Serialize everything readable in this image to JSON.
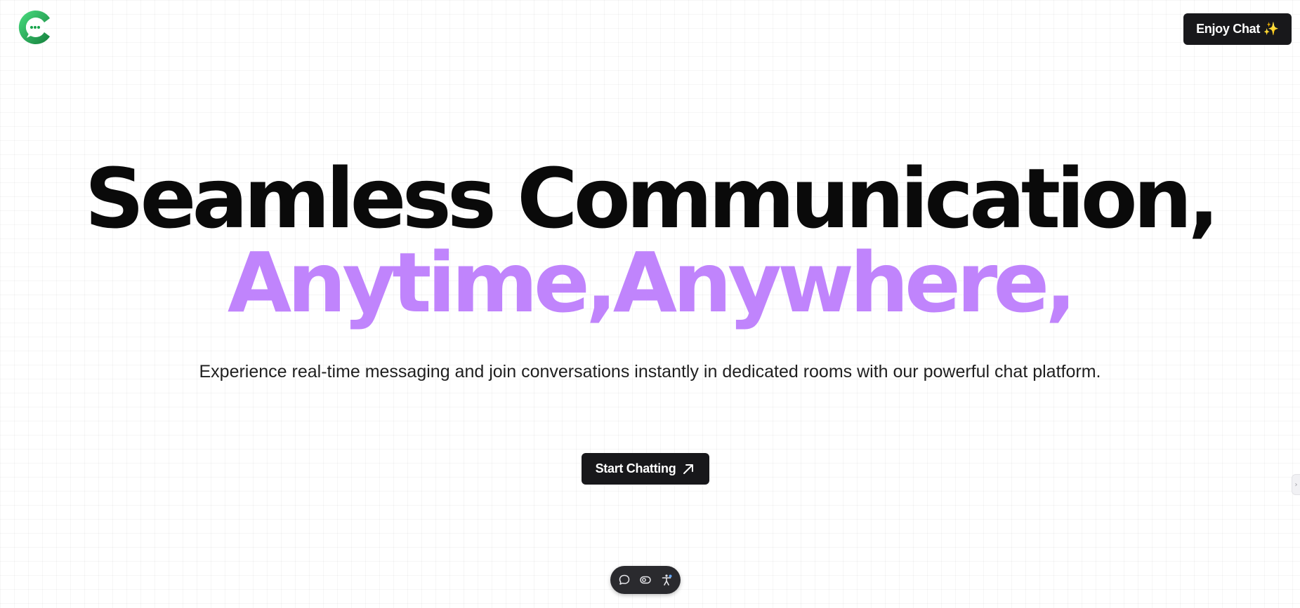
{
  "header": {
    "logo_icon": "chat-bubble-logo-icon",
    "enjoy_button_label": "Enjoy Chat ✨"
  },
  "hero": {
    "headline_line1": "Seamless Communication,",
    "headline_line2": "Anytime,Anywhere,",
    "subtitle": "Experience real-time messaging and join conversations instantly in dedicated rooms with our powerful chat platform.",
    "cta_label": "Start Chatting",
    "cta_icon": "arrow-up-right-icon"
  },
  "dock": {
    "icons": [
      "chat-bubble-icon",
      "toggle-icon",
      "accessibility-icon"
    ]
  },
  "side_tab": {
    "label": "›"
  },
  "colors": {
    "accent": "#c084fc",
    "dark": "#18181b",
    "logo_green": "#22c55e",
    "text": "#0a0a0a"
  }
}
